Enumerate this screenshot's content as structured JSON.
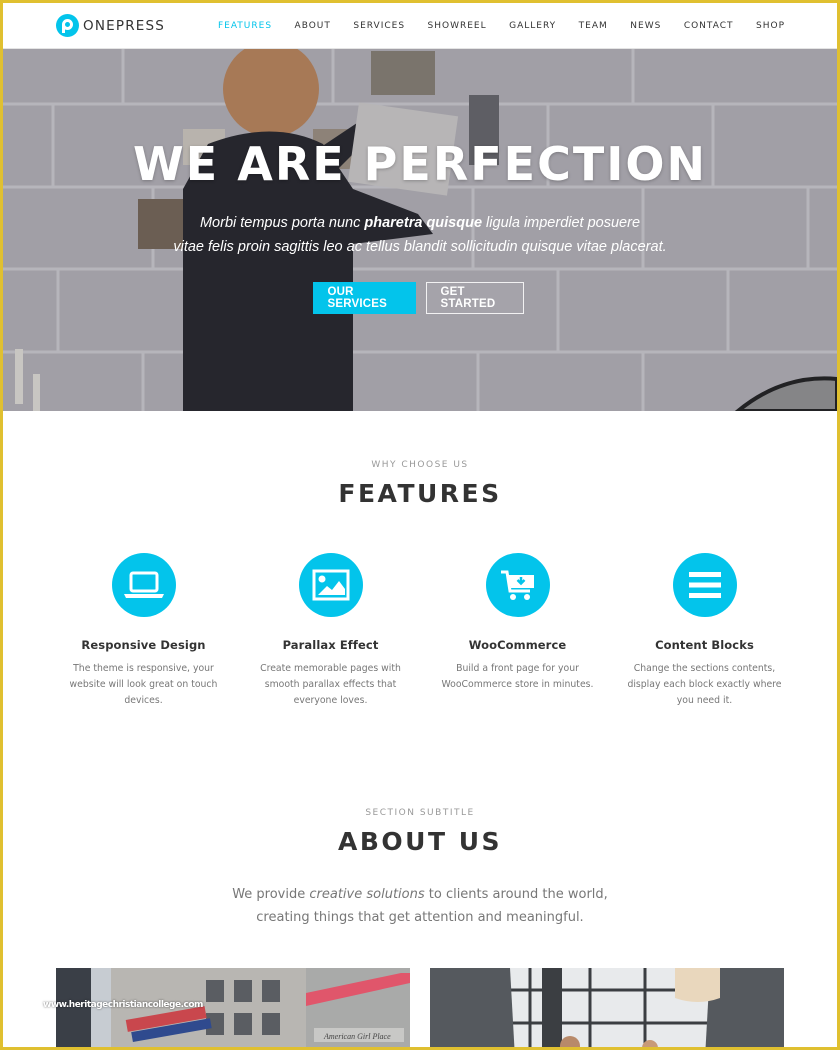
{
  "brand": {
    "name": "ONEPRESS",
    "accent_color": "#03c4eb",
    "frame_color": "#e0c030"
  },
  "nav": {
    "items": [
      {
        "label": "FEATURES",
        "active": true
      },
      {
        "label": "ABOUT"
      },
      {
        "label": "SERVICES"
      },
      {
        "label": "SHOWREEL"
      },
      {
        "label": "GALLERY"
      },
      {
        "label": "TEAM"
      },
      {
        "label": "NEWS"
      },
      {
        "label": "CONTACT"
      },
      {
        "label": "SHOP"
      }
    ]
  },
  "hero": {
    "title": "WE ARE PERFECTION",
    "subtitle_part1": "Morbi tempus porta nunc ",
    "subtitle_bold": "pharetra quisque",
    "subtitle_part2": " ligula imperdiet posuere",
    "subtitle_line2": "vitae felis proin sagittis leo ac tellus blandit sollicitudin quisque vitae placerat.",
    "primary_button": "OUR SERVICES",
    "secondary_button": "GET STARTED"
  },
  "features": {
    "subtitle": "WHY CHOOSE US",
    "title": "FEATURES",
    "items": [
      {
        "icon": "laptop-icon",
        "title": "Responsive Design",
        "description": "The theme is responsive, your website will look great on touch devices."
      },
      {
        "icon": "image-icon",
        "title": "Parallax Effect",
        "description": "Create memorable pages with smooth parallax effects that everyone loves."
      },
      {
        "icon": "cart-download-icon",
        "title": "WooCommerce",
        "description": "Build a front page for your WooCommerce store in minutes."
      },
      {
        "icon": "bars-icon",
        "title": "Content Blocks",
        "description": "Change the sections contents, display each block exactly where you need it."
      }
    ]
  },
  "about": {
    "subtitle": "SECTION SUBTITLE",
    "title": "ABOUT US",
    "text_part1": "We provide ",
    "text_italic": "creative solutions",
    "text_part2": " to clients around the world,",
    "text_line2": "creating things that get attention and meaningful.",
    "storefront_sign": "American Girl Place"
  },
  "watermark": "www.heritagechristiancollege.com"
}
